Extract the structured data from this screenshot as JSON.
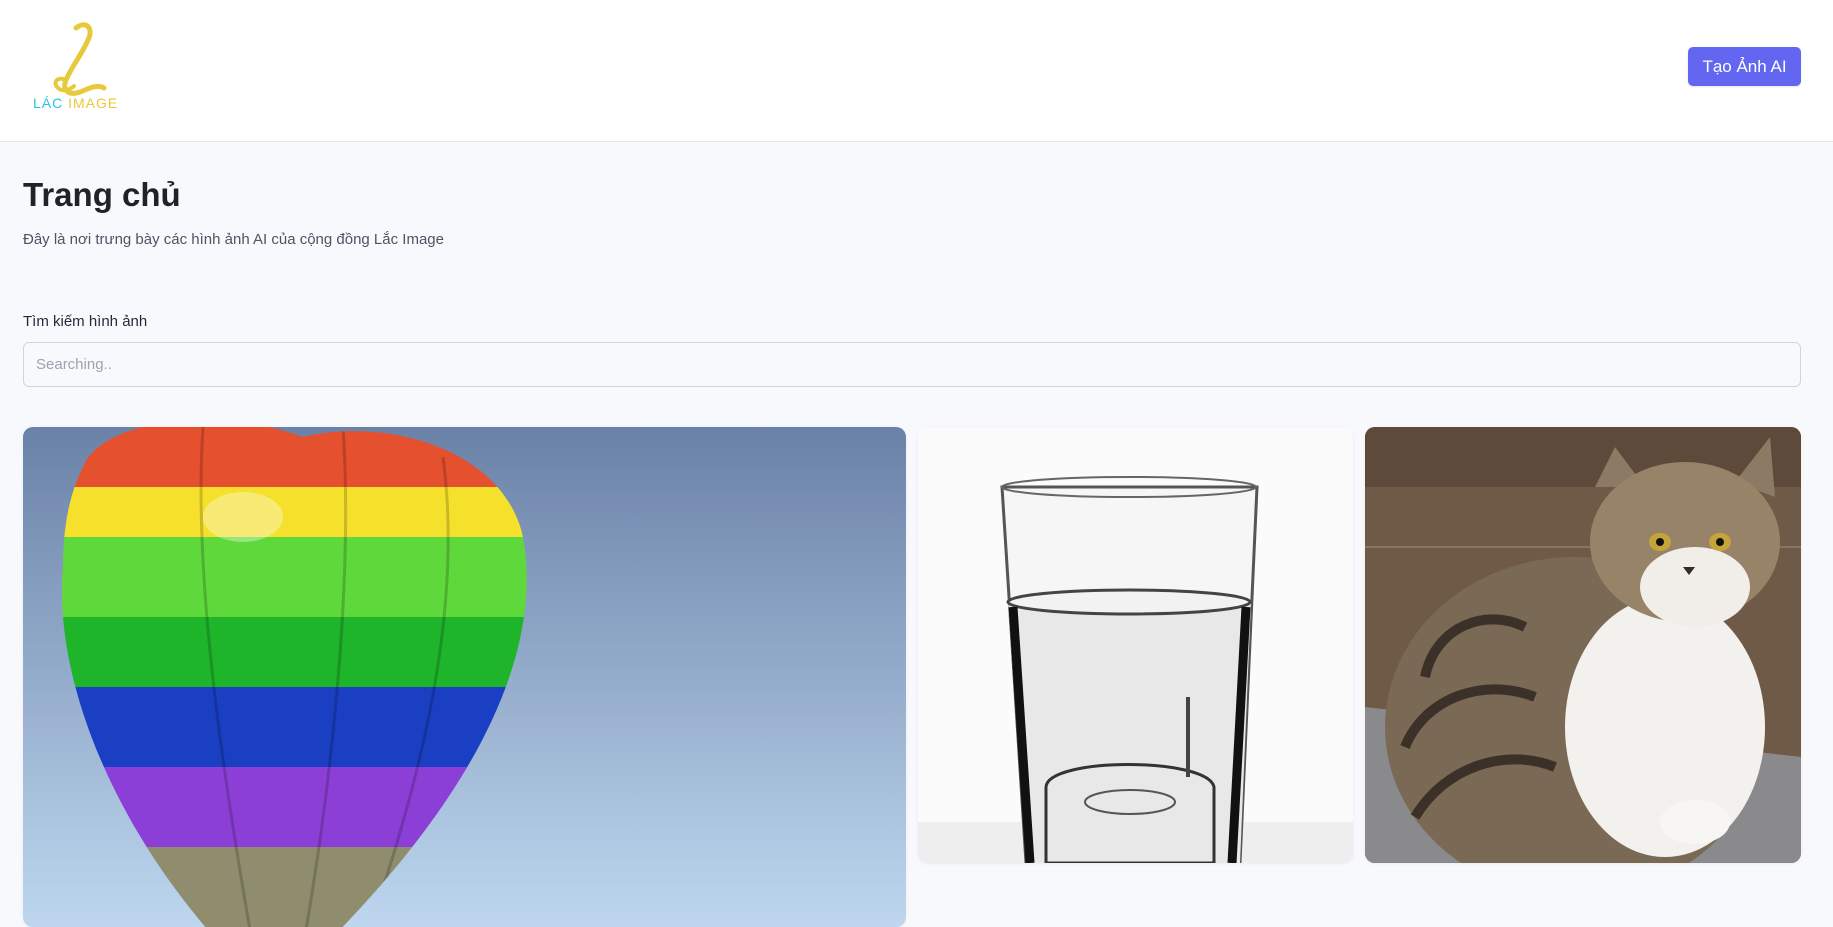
{
  "header": {
    "logo": {
      "text_part1": "LÁC",
      "text_part2": "IMAGE",
      "icon": "lac-image-logo"
    },
    "create_button_label": "Tạo Ảnh AI"
  },
  "main": {
    "title": "Trang chủ",
    "subtitle": "Đây là nơi trưng bày các hình ảnh AI của cộng đồng Lắc Image",
    "search": {
      "label": "Tìm kiếm hình ảnh",
      "placeholder": "Searching..",
      "value": ""
    },
    "gallery": [
      {
        "subject": "hot-air-balloon"
      },
      {
        "subject": "glass-of-water"
      },
      {
        "subject": "tabby-cat"
      }
    ]
  },
  "colors": {
    "accent": "#6366f1",
    "logo_cyan": "#22c7e0",
    "logo_yellow": "#e8c93a",
    "page_bg": "#f8f9fc"
  }
}
